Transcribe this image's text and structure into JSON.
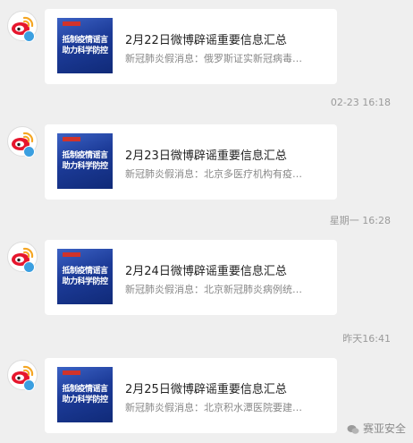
{
  "messages": [
    {
      "title": "2月22日微博辟谣重要信息汇总",
      "desc": "新冠肺炎假消息：俄罗斯证实新冠病毒…",
      "thumb_line1": "抵制疫情谣言",
      "thumb_line2": "助力科学防控"
    },
    {
      "title": "2月23日微博辟谣重要信息汇总",
      "desc": "新冠肺炎假消息：北京多医疗机构有疫…",
      "thumb_line1": "抵制疫情谣言",
      "thumb_line2": "助力科学防控"
    },
    {
      "title": "2月24日微博辟谣重要信息汇总",
      "desc": "新冠肺炎假消息：北京新冠肺炎病例统…",
      "thumb_line1": "抵制疫情谣言",
      "thumb_line2": "助力科学防控"
    },
    {
      "title": "2月25日微博辟谣重要信息汇总",
      "desc": "新冠肺炎假消息：北京积水潭医院要建…",
      "thumb_line1": "抵制疫情谣言",
      "thumb_line2": "助力科学防控"
    }
  ],
  "timestamps": [
    "02-23 16:18",
    "星期一 16:28",
    "昨天16:41"
  ],
  "watermark": "赛亚安全",
  "colors": {
    "background": "#efefef",
    "card": "#ffffff",
    "weibo_red": "#e6162d",
    "weibo_orange": "#f5a623",
    "verify_blue": "#3b9fe0",
    "thumb_blue": "#1c3b98"
  },
  "icons": {
    "avatar": "weibo-logo-icon",
    "badge": "verified-badge-icon"
  }
}
